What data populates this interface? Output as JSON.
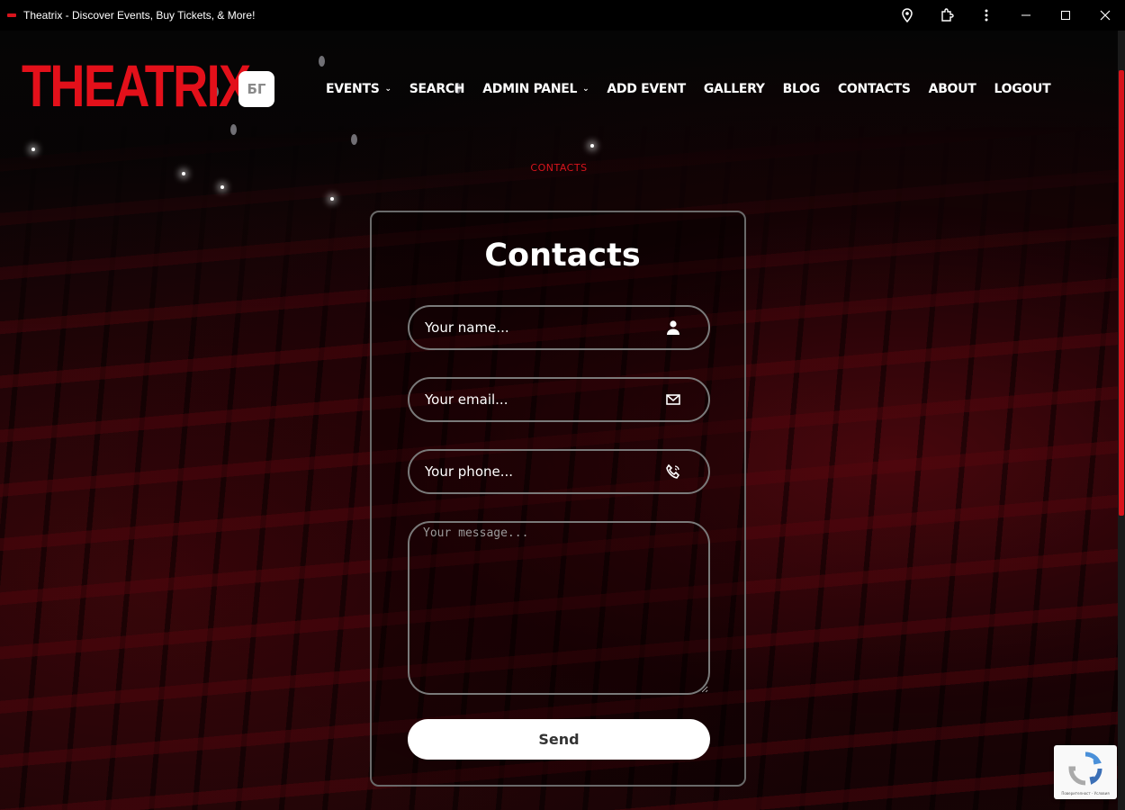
{
  "browser": {
    "title": "Theatrix - Discover Events, Buy Tickets, & More!"
  },
  "header": {
    "logo": "THEATRIX",
    "lang_button": "БГ",
    "nav": [
      {
        "label": "EVENTS",
        "dropdown": true
      },
      {
        "label": "SEARCH",
        "dropdown": false
      },
      {
        "label": "ADMIN PANEL",
        "dropdown": true
      },
      {
        "label": "ADD EVENT",
        "dropdown": false
      },
      {
        "label": "GALLERY",
        "dropdown": false
      },
      {
        "label": "BLOG",
        "dropdown": false
      },
      {
        "label": "CONTACTS",
        "dropdown": false
      },
      {
        "label": "ABOUT",
        "dropdown": false
      },
      {
        "label": "LOGOUT",
        "dropdown": false
      }
    ]
  },
  "breadcrumb": "CONTACTS",
  "form": {
    "title": "Contacts",
    "name_placeholder": "Your name...",
    "email_placeholder": "Your email...",
    "phone_placeholder": "Your phone...",
    "message_placeholder": "Your message...",
    "send_label": "Send"
  },
  "recaptcha": {
    "text": "Поверителност - Условия"
  },
  "colors": {
    "accent": "#d7141c",
    "logo": "#e3101a"
  },
  "icons": {
    "name_field": "user-icon",
    "email_field": "envelope-icon",
    "phone_field": "phone-icon"
  }
}
